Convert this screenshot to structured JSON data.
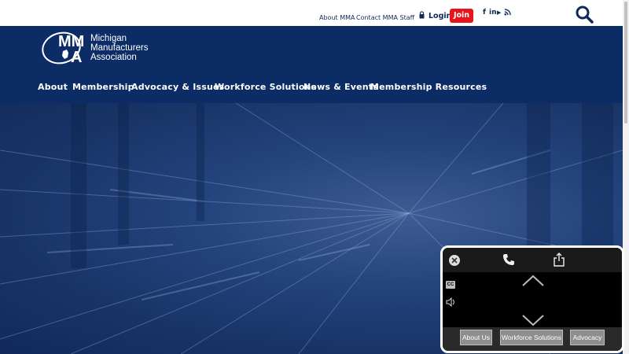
{
  "topbar": {
    "links": [
      "About MMA",
      "Contact MMA Staff"
    ],
    "login_label": "Login",
    "join_label": "Join",
    "social": {
      "facebook": "f",
      "linkedin": "in",
      "youtube": "▶",
      "rss": "RSS"
    }
  },
  "header": {
    "logo_mark": "MMA",
    "logo_lines": [
      "Michigan",
      "Manufacturers",
      "Association"
    ],
    "nav": [
      "About",
      "Membership",
      "Advocacy & Issues",
      "Workforce Solutions",
      "News & Events",
      "Membership Resources"
    ]
  },
  "widget": {
    "cc_label": "CC",
    "buttons": [
      "About Us",
      "Workforce Solutions",
      "Advocacy"
    ]
  },
  "colors": {
    "brand_navy": "#0c2c66",
    "join_red": "#e8141c",
    "text_navy": "#10295a"
  },
  "icons": [
    "lock-icon",
    "search-icon",
    "facebook-icon",
    "linkedin-icon",
    "youtube-icon",
    "rss-icon",
    "close-icon",
    "phone-icon",
    "share-icon",
    "chevron-up-icon",
    "chevron-down-icon",
    "volume-icon",
    "cc-icon"
  ]
}
